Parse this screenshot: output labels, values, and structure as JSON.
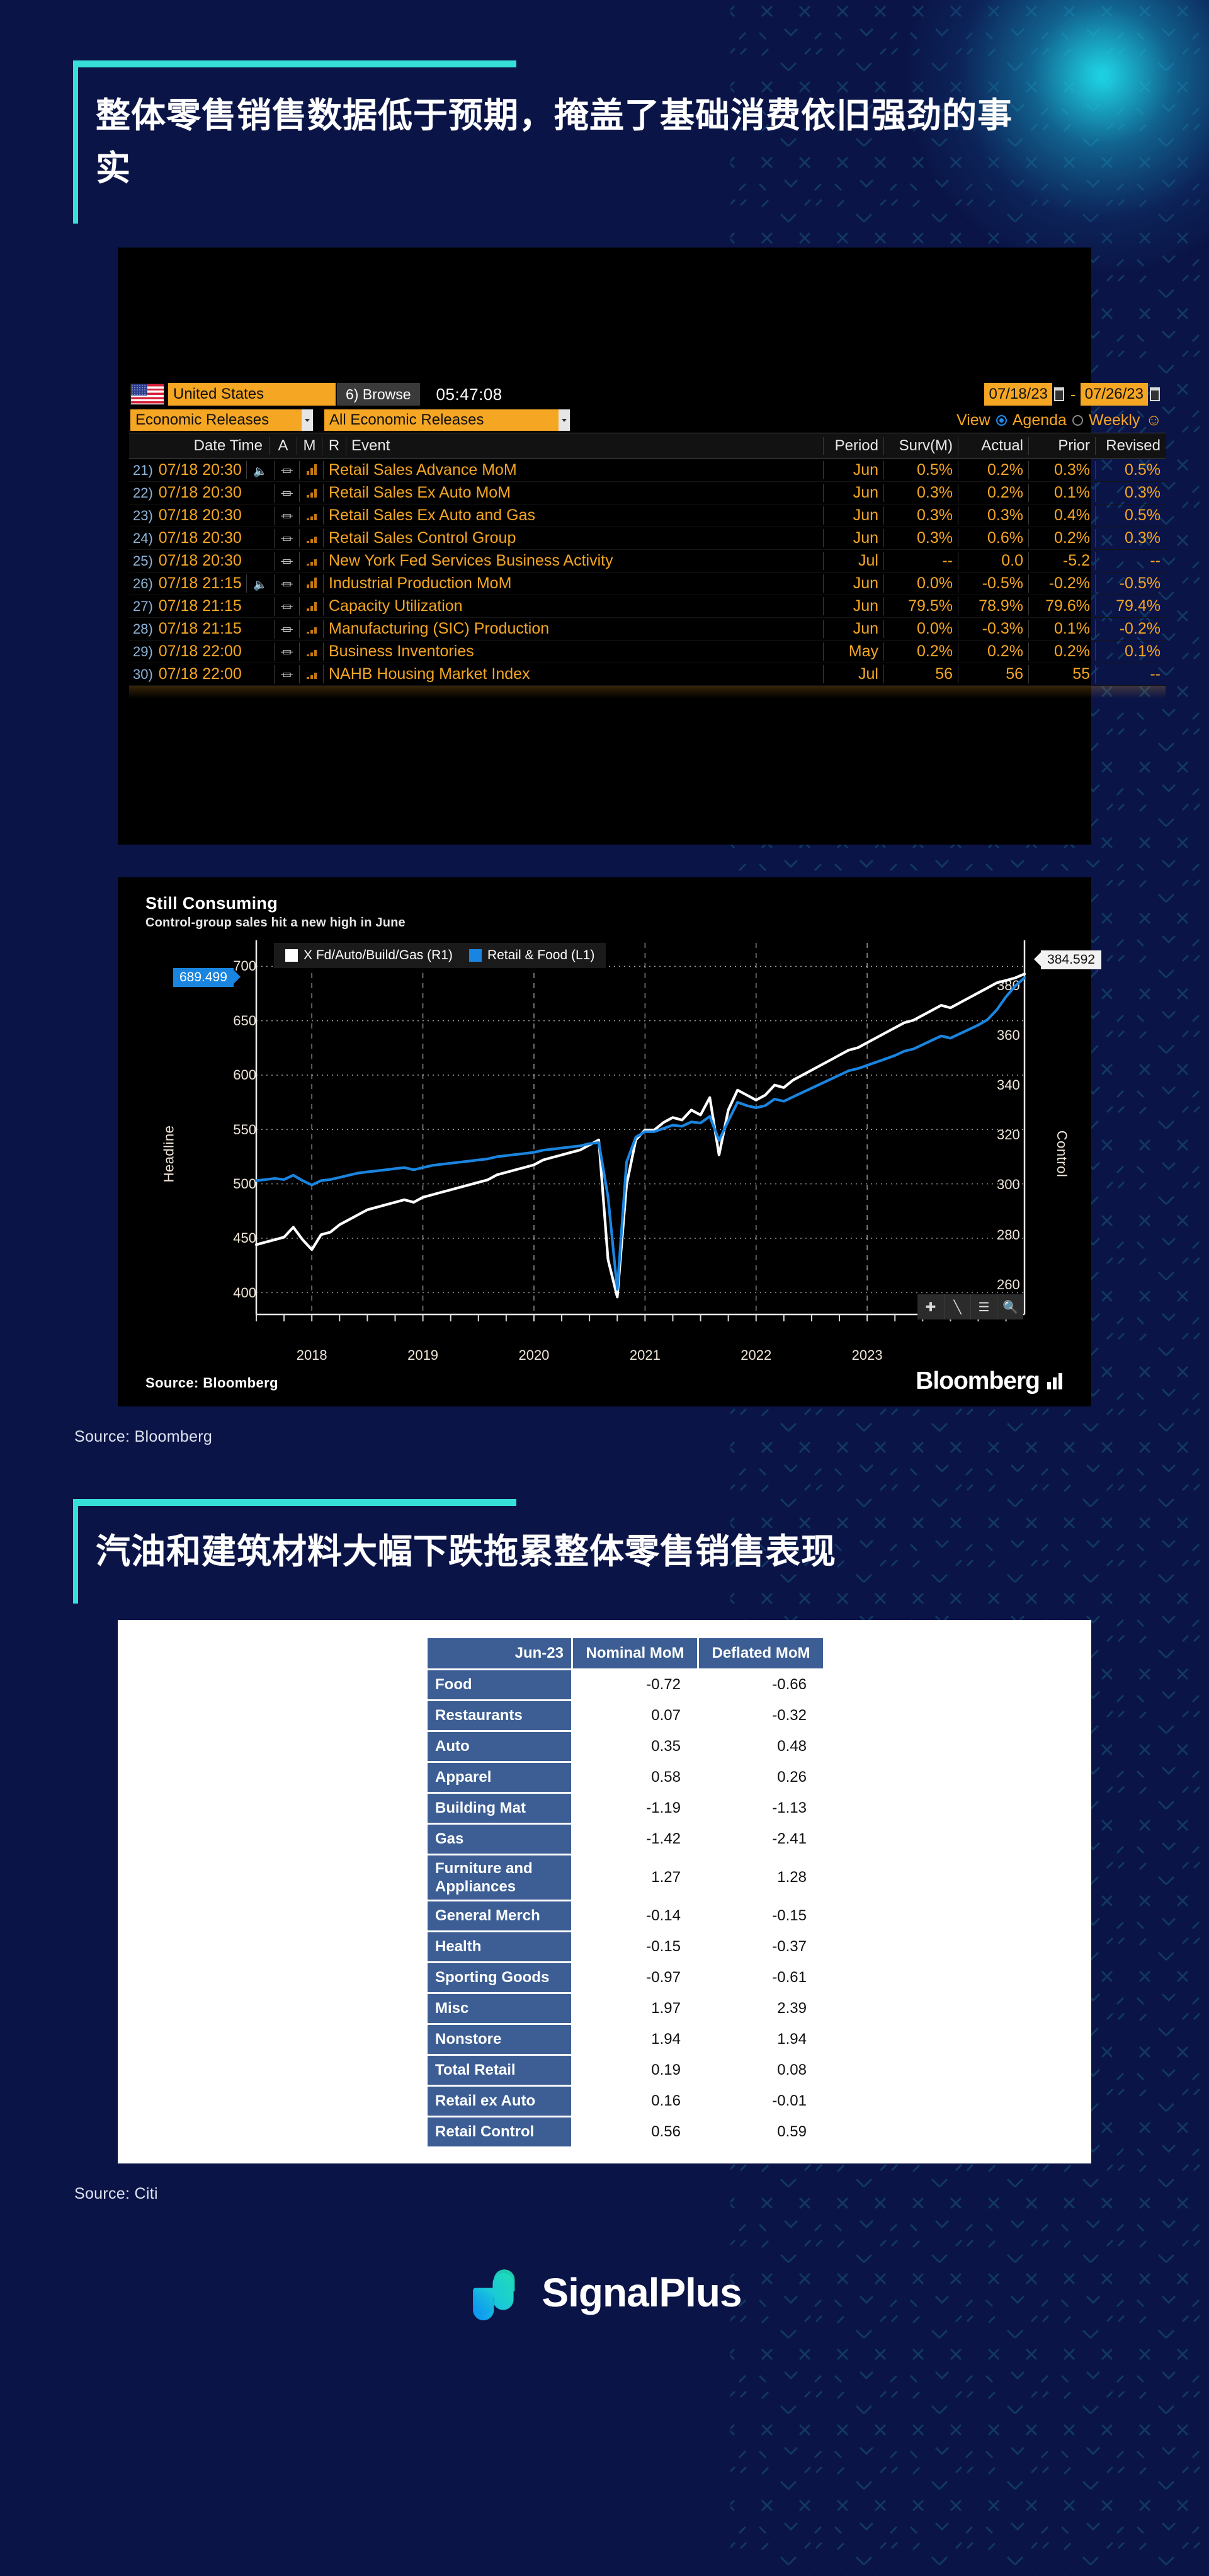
{
  "headings": {
    "h1": "整体零售销售数据低于预期，掩盖了基础消费依旧强劲的事实",
    "h2": "汽油和建筑材料大幅下跌拖累整体零售销售表现"
  },
  "sources": {
    "bloomberg": "Source: Bloomberg",
    "citi": "Source: Citi"
  },
  "terminal": {
    "country": "United States",
    "browse_label": "Browse",
    "browse_num": "6)",
    "clock": "05:47:08",
    "date_from": "07/18/23",
    "date_to": "07/26/23",
    "dash": "-",
    "category": "Economic Releases",
    "filter": "All Economic Releases",
    "view_label": "View",
    "agenda_label": "Agenda",
    "weekly_label": "Weekly",
    "columns": {
      "datetime": "Date Time",
      "a": "A",
      "m": "M",
      "r": "R",
      "event": "Event",
      "period": "Period",
      "surv": "Surv(M)",
      "actual": "Actual",
      "prior": "Prior",
      "revised": "Revised"
    },
    "rows": [
      {
        "n": "21)",
        "dt": "07/18 20:30",
        "speaker": true,
        "bars": "b1",
        "event": "Retail Sales Advance MoM",
        "period": "Jun",
        "surv": "0.5%",
        "actual": "0.2%",
        "prior": "0.3%",
        "revised": "0.5%"
      },
      {
        "n": "22)",
        "dt": "07/18 20:30",
        "speaker": false,
        "bars": "b2",
        "event": "Retail Sales Ex Auto MoM",
        "period": "Jun",
        "surv": "0.3%",
        "actual": "0.2%",
        "prior": "0.1%",
        "revised": "0.3%"
      },
      {
        "n": "23)",
        "dt": "07/18 20:30",
        "speaker": false,
        "bars": "b3",
        "event": "Retail Sales Ex Auto and Gas",
        "period": "Jun",
        "surv": "0.3%",
        "actual": "0.3%",
        "prior": "0.4%",
        "revised": "0.5%"
      },
      {
        "n": "24)",
        "dt": "07/18 20:30",
        "speaker": false,
        "bars": "b3",
        "event": "Retail Sales Control Group",
        "period": "Jun",
        "surv": "0.3%",
        "actual": "0.6%",
        "prior": "0.2%",
        "revised": "0.3%"
      },
      {
        "n": "25)",
        "dt": "07/18 20:30",
        "speaker": false,
        "bars": "b3",
        "event": "New York Fed Services Business Activity",
        "period": "Jul",
        "surv": "--",
        "actual": "0.0",
        "prior": "-5.2",
        "revised": "--"
      },
      {
        "n": "26)",
        "dt": "07/18 21:15",
        "speaker": true,
        "bars": "b1",
        "event": "Industrial Production MoM",
        "period": "Jun",
        "surv": "0.0%",
        "actual": "-0.5%",
        "prior": "-0.2%",
        "revised": "-0.5%"
      },
      {
        "n": "27)",
        "dt": "07/18 21:15",
        "speaker": false,
        "bars": "b2",
        "event": "Capacity Utilization",
        "period": "Jun",
        "surv": "79.5%",
        "actual": "78.9%",
        "prior": "79.6%",
        "revised": "79.4%"
      },
      {
        "n": "28)",
        "dt": "07/18 21:15",
        "speaker": false,
        "bars": "b3",
        "event": "Manufacturing (SIC) Production",
        "period": "Jun",
        "surv": "0.0%",
        "actual": "-0.3%",
        "prior": "0.1%",
        "revised": "-0.2%"
      },
      {
        "n": "29)",
        "dt": "07/18 22:00",
        "speaker": false,
        "bars": "b3",
        "event": "Business Inventories",
        "period": "May",
        "surv": "0.2%",
        "actual": "0.2%",
        "prior": "0.2%",
        "revised": "0.1%"
      },
      {
        "n": "30)",
        "dt": "07/18 22:00",
        "speaker": false,
        "bars": "b3",
        "event": "NAHB Housing Market Index",
        "period": "Jul",
        "surv": "56",
        "actual": "56",
        "prior": "55",
        "revised": "--"
      }
    ]
  },
  "chart_footer": {
    "source": "Source: Bloomberg",
    "brand": "Bloomberg"
  },
  "chart_data": {
    "type": "line",
    "title": "Still Consuming",
    "subtitle": "Control-group sales hit a new high in June",
    "xlabel": "",
    "ylabel": "Headline",
    "y2label": "Control",
    "ylim": [
      380,
      710
    ],
    "y2lim": [
      248,
      392
    ],
    "yticks": [
      400,
      450,
      500,
      550,
      600,
      650,
      700
    ],
    "y2ticks": [
      260,
      280,
      300,
      320,
      340,
      360,
      380
    ],
    "xticks": [
      "2018",
      "2019",
      "2020",
      "2021",
      "2022",
      "2023"
    ],
    "grid": true,
    "legend_position": "top-left",
    "annotations": [
      {
        "text": "689.499",
        "axis": "left",
        "value": 689.499,
        "color": "#1a85e0"
      },
      {
        "text": "384.592",
        "axis": "right",
        "value": 384.592,
        "color": "#f2f2f2"
      }
    ],
    "series": [
      {
        "name": "X Fd/Auto/Build/Gas (R1)",
        "color": "#ffffff",
        "axis": "right",
        "values": [
          276,
          277,
          278,
          279,
          283,
          278,
          274,
          280,
          281,
          284,
          286,
          288,
          290,
          291,
          292,
          293,
          294,
          293,
          295,
          296,
          297,
          298,
          299,
          300,
          301,
          302,
          304,
          305,
          306,
          307,
          308,
          310,
          311,
          312,
          313,
          314,
          316,
          318,
          270,
          255,
          300,
          318,
          322,
          322,
          325,
          327,
          326,
          330,
          328,
          335,
          312,
          330,
          338,
          336,
          334,
          336,
          340,
          339,
          342,
          344,
          346,
          348,
          350,
          352,
          354,
          355,
          357,
          359,
          361,
          363,
          365,
          366,
          368,
          370,
          372,
          371,
          373,
          375,
          377,
          379,
          381,
          382,
          383,
          384.592
        ]
      },
      {
        "name": "Retail & Food (L1)",
        "color": "#1a85e0",
        "axis": "left",
        "values": [
          503,
          504,
          505,
          504,
          508,
          503,
          499,
          503,
          504,
          506,
          508,
          510,
          511,
          512,
          513,
          514,
          515,
          513,
          515,
          517,
          518,
          519,
          520,
          521,
          522,
          523,
          525,
          526,
          527,
          528,
          529,
          531,
          532,
          533,
          534,
          535,
          537,
          538,
          488,
          403,
          520,
          543,
          548,
          548,
          551,
          554,
          553,
          557,
          556,
          562,
          540,
          558,
          575,
          572,
          570,
          572,
          578,
          576,
          580,
          584,
          588,
          592,
          596,
          600,
          604,
          606,
          609,
          612,
          615,
          618,
          622,
          624,
          628,
          632,
          636,
          634,
          638,
          642,
          646,
          651,
          660,
          672,
          682,
          689.499
        ]
      }
    ]
  },
  "citi_table": {
    "headers": [
      "Jun-23",
      "Nominal MoM",
      "Deflated MoM"
    ],
    "rows": [
      {
        "label": "Food",
        "nominal": "-0.72",
        "deflated": "-0.66"
      },
      {
        "label": "Restaurants",
        "nominal": "0.07",
        "deflated": "-0.32"
      },
      {
        "label": "Auto",
        "nominal": "0.35",
        "deflated": "0.48"
      },
      {
        "label": "Apparel",
        "nominal": "0.58",
        "deflated": "0.26"
      },
      {
        "label": "Building Mat",
        "nominal": "-1.19",
        "deflated": "-1.13"
      },
      {
        "label": "Gas",
        "nominal": "-1.42",
        "deflated": "-2.41"
      },
      {
        "label": "Furniture and Appliances",
        "nominal": "1.27",
        "deflated": "1.28",
        "two_line": true
      },
      {
        "label": "General Merch",
        "nominal": "-0.14",
        "deflated": "-0.15"
      },
      {
        "label": "Health",
        "nominal": "-0.15",
        "deflated": "-0.37"
      },
      {
        "label": "Sporting Goods",
        "nominal": "-0.97",
        "deflated": "-0.61"
      },
      {
        "label": "Misc",
        "nominal": "1.97",
        "deflated": "2.39"
      },
      {
        "label": "Nonstore",
        "nominal": "1.94",
        "deflated": "1.94"
      },
      {
        "label": "Total Retail",
        "nominal": "0.19",
        "deflated": "0.08"
      },
      {
        "label": "Retail ex Auto",
        "nominal": "0.16",
        "deflated": "-0.01"
      },
      {
        "label": "Retail Control",
        "nominal": "0.56",
        "deflated": "0.59"
      }
    ]
  },
  "footer": {
    "brand": "SignalPlus"
  },
  "colors": {
    "page_bg": "#0b1446",
    "accent": "#36e0d8",
    "terminal_orange": "#f5a623",
    "series_blue": "#1a85e0",
    "citi_header": "#3c5e94"
  }
}
